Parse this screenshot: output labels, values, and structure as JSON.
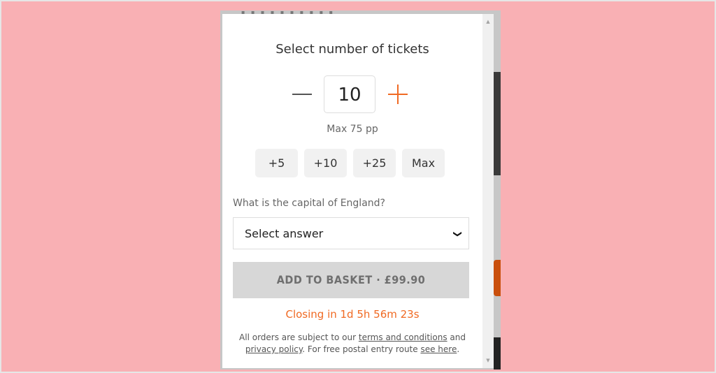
{
  "modal": {
    "title": "Select number of tickets",
    "quantity": {
      "value": "10",
      "minus_icon": "minus-icon",
      "plus_icon": "plus-icon",
      "max_label": "Max 75 pp"
    },
    "quick_add": [
      {
        "label": "+5"
      },
      {
        "label": "+10"
      },
      {
        "label": "+25"
      },
      {
        "label": "Max"
      }
    ],
    "question": {
      "label": "What is the capital of England?",
      "select_value": "Select answer",
      "chevron_icon": "chevron-down-icon"
    },
    "add_to_basket": {
      "label": "ADD TO BASKET · £99.90",
      "enabled": false
    },
    "countdown": "Closing in 1d 5h 56m 23s",
    "footer": {
      "text1": "All orders are subject to our ",
      "terms_link": "terms and conditions",
      "text2": " and ",
      "privacy_link": "privacy policy",
      "text3": ". For free postal entry route ",
      "see_here_link": "see here",
      "text4": "."
    }
  },
  "colors": {
    "accent": "#f06a23",
    "background": "#f9b0b4",
    "button_disabled": "#d7d7d7"
  }
}
